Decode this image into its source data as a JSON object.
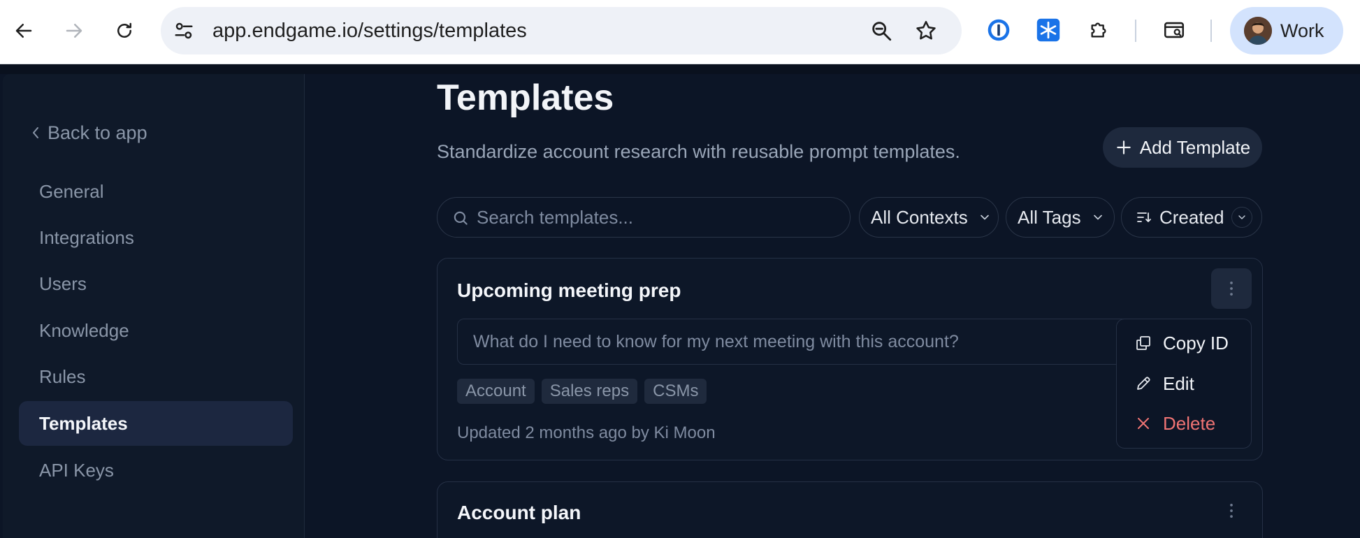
{
  "browser": {
    "url": "app.endgame.io/settings/templates",
    "profile_name": "Work",
    "icons": [
      "back-arrow-icon",
      "forward-arrow-icon",
      "reload-icon",
      "site-settings-icon",
      "zoom-icon",
      "bookmark-star-icon",
      "password-manager-icon",
      "snowflake-extension-icon",
      "extensions-puzzle-icon",
      "tab-search-icon"
    ]
  },
  "sidebar": {
    "back_label": "Back to app",
    "items": [
      {
        "label": "General"
      },
      {
        "label": "Integrations"
      },
      {
        "label": "Users"
      },
      {
        "label": "Knowledge"
      },
      {
        "label": "Rules"
      },
      {
        "label": "Templates",
        "active": true
      },
      {
        "label": "API Keys"
      }
    ]
  },
  "page": {
    "title": "Templates",
    "subtitle": "Standardize account research with reusable prompt templates.",
    "add_button": "Add Template"
  },
  "toolbar": {
    "search_placeholder": "Search templates...",
    "contexts_filter": "All Contexts",
    "tags_filter": "All Tags",
    "sort_label": "Created"
  },
  "templates": [
    {
      "title": "Upcoming meeting prep",
      "prompt": "What do I need to know for my next meeting with this account?",
      "tags": [
        "Account",
        "Sales reps",
        "CSMs"
      ],
      "updated": "Updated 2 months ago by Ki Moon"
    },
    {
      "title": "Account plan"
    }
  ],
  "context_menu": {
    "items": [
      {
        "label": "Copy ID",
        "icon": "copy-icon"
      },
      {
        "label": "Edit",
        "icon": "pencil-icon"
      },
      {
        "label": "Delete",
        "icon": "close-icon",
        "danger": true
      }
    ]
  },
  "colors": {
    "background": "#0c1526",
    "sidebar": "#0f1929",
    "active_nav": "#1c2740",
    "danger": "#f07474",
    "chrome_profile": "#d3e3fd"
  }
}
